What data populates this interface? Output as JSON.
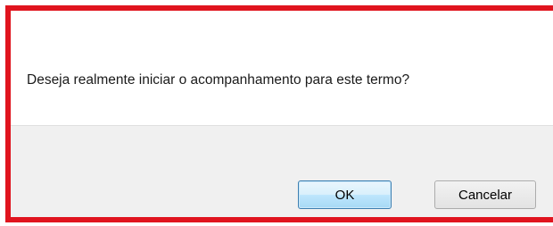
{
  "dialog": {
    "message": "Deseja realmente iniciar o acompanhamento para este termo?",
    "buttons": {
      "ok_label": "OK",
      "cancel_label": "Cancelar"
    },
    "colors": {
      "highlight_border": "#e0141e",
      "button_bar_bg": "#f0f0f0",
      "default_button_border": "#3c7fb1"
    }
  }
}
